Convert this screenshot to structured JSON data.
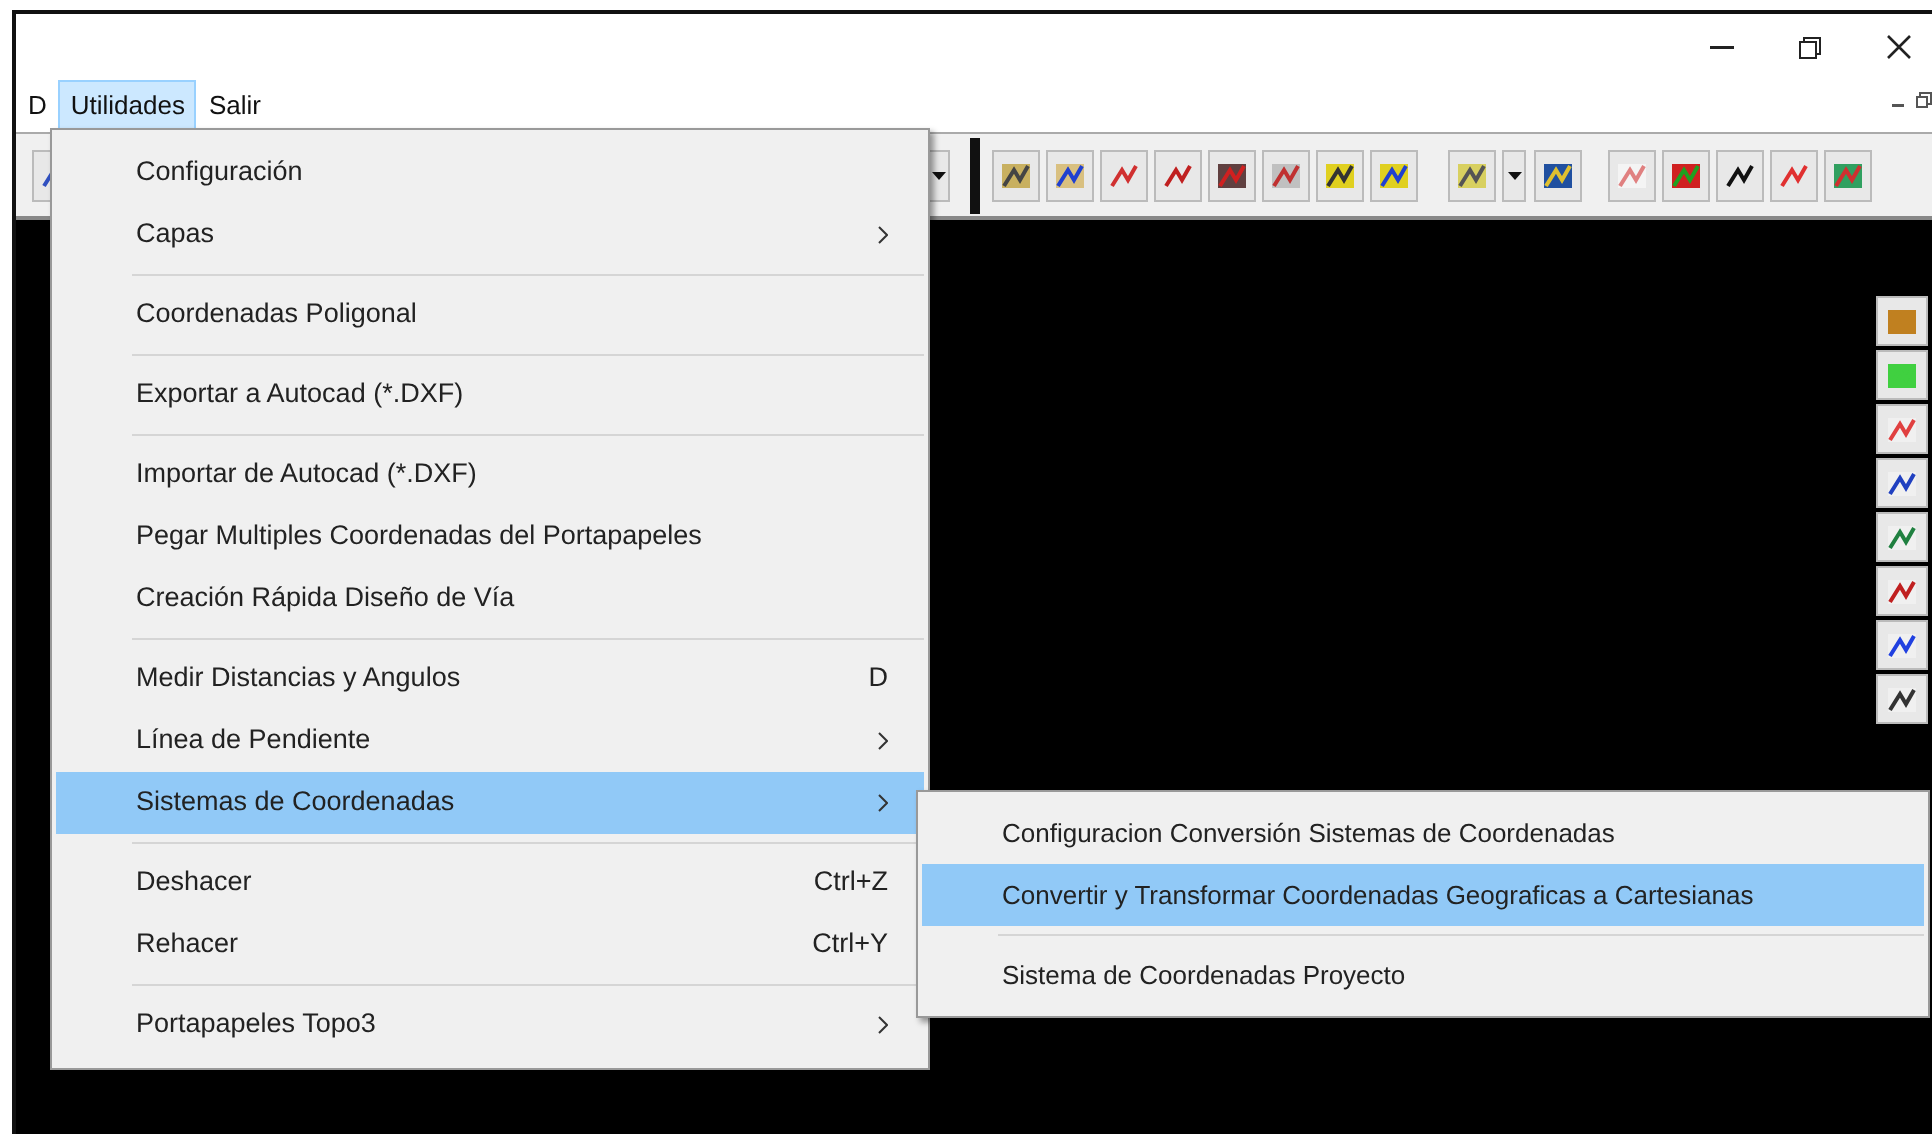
{
  "menu_bar": [
    {
      "label": "D",
      "selected": false
    },
    {
      "label": "Utilidades",
      "selected": true
    },
    {
      "label": "Salir",
      "selected": false
    }
  ],
  "dropdown": [
    {
      "kind": "item",
      "label": "Configuración",
      "submenu": false,
      "selected": false
    },
    {
      "kind": "item",
      "label": "Capas",
      "submenu": true,
      "selected": false
    },
    {
      "kind": "separator"
    },
    {
      "kind": "item",
      "label": "Coordenadas Poligonal",
      "submenu": false,
      "selected": false
    },
    {
      "kind": "separator"
    },
    {
      "kind": "item",
      "label": "Exportar a Autocad (*.DXF)",
      "submenu": false,
      "selected": false
    },
    {
      "kind": "separator"
    },
    {
      "kind": "item",
      "label": "Importar de Autocad (*.DXF)",
      "submenu": false,
      "selected": false
    },
    {
      "kind": "item",
      "label": "Pegar Multiples Coordenadas del Portapapeles",
      "submenu": false,
      "selected": false
    },
    {
      "kind": "item",
      "label": "Creación Rápida Diseño de Vía",
      "submenu": false,
      "selected": false
    },
    {
      "kind": "separator"
    },
    {
      "kind": "item",
      "label": "Medir Distancias y Angulos",
      "shortcut": "D",
      "submenu": false,
      "selected": false
    },
    {
      "kind": "item",
      "label": "Línea de Pendiente",
      "submenu": true,
      "selected": false
    },
    {
      "kind": "item",
      "label": "Sistemas de Coordenadas",
      "submenu": true,
      "selected": true
    },
    {
      "kind": "separator"
    },
    {
      "kind": "item",
      "label": "Deshacer",
      "shortcut": "Ctrl+Z",
      "submenu": false,
      "selected": false
    },
    {
      "kind": "item",
      "label": "Rehacer",
      "shortcut": "Ctrl+Y",
      "submenu": false,
      "selected": false
    },
    {
      "kind": "separator"
    },
    {
      "kind": "item",
      "label": "Portapapeles Topo3",
      "submenu": true,
      "selected": false
    }
  ],
  "submenu": [
    {
      "kind": "item",
      "label": "Configuracion Conversión Sistemas de Coordenadas",
      "selected": false
    },
    {
      "kind": "item",
      "label": "Convertir y Transformar Coordenadas Geograficas a Cartesianas",
      "selected": true
    },
    {
      "kind": "separator"
    },
    {
      "kind": "item",
      "label": "Sistema de Coordenadas Proyecto",
      "selected": false
    }
  ]
}
